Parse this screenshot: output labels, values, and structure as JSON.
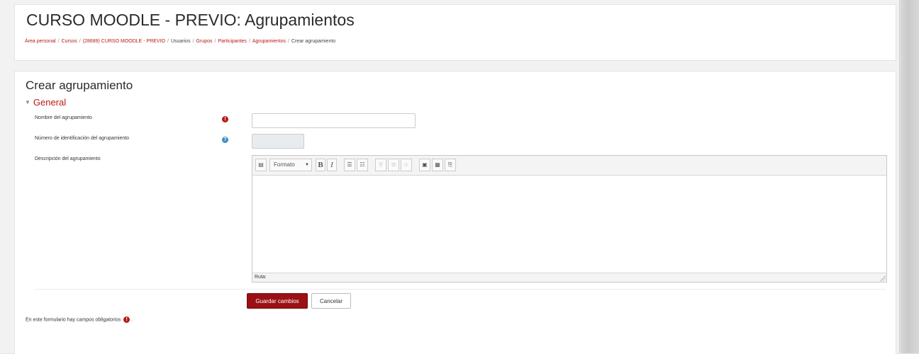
{
  "header": {
    "title": "CURSO MOODLE - PREVIO: Agrupamientos",
    "breadcrumb": [
      {
        "label": "Área personal",
        "link": true
      },
      {
        "label": "Cursos",
        "link": true
      },
      {
        "label": "(28689) CURSO MOODLE - PREVIO",
        "link": true
      },
      {
        "label": "Usuarios",
        "link": false
      },
      {
        "label": "Grupos",
        "link": true
      },
      {
        "label": "Participantes",
        "link": true
      },
      {
        "label": "Agrupamientos",
        "link": true
      },
      {
        "label": "Crear agrupamiento",
        "link": false
      }
    ],
    "separator": "/"
  },
  "form": {
    "title": "Crear agrupamiento",
    "section": "General",
    "fields": {
      "name": {
        "label": "Nombre del agrupamiento",
        "value": "",
        "required_icon": "exclamation-icon"
      },
      "id_number": {
        "label": "Número de identificación del agrupamiento",
        "value": "",
        "help_icon": "question-icon"
      },
      "description": {
        "label": "Descripción del agrupamiento",
        "value": ""
      }
    },
    "editor": {
      "format_select": "Formato",
      "bold": "B",
      "italic": "I",
      "footer_path": "Ruta:"
    },
    "buttons": {
      "save": "Guardar cambios",
      "cancel": "Cancelar"
    },
    "required_note": "En este formulario hay campos obligatorios",
    "required_note_suffix": "."
  },
  "colors": {
    "accent": "#b71a14",
    "primary_button": "#9a1014",
    "help": "#3d8fc4"
  }
}
